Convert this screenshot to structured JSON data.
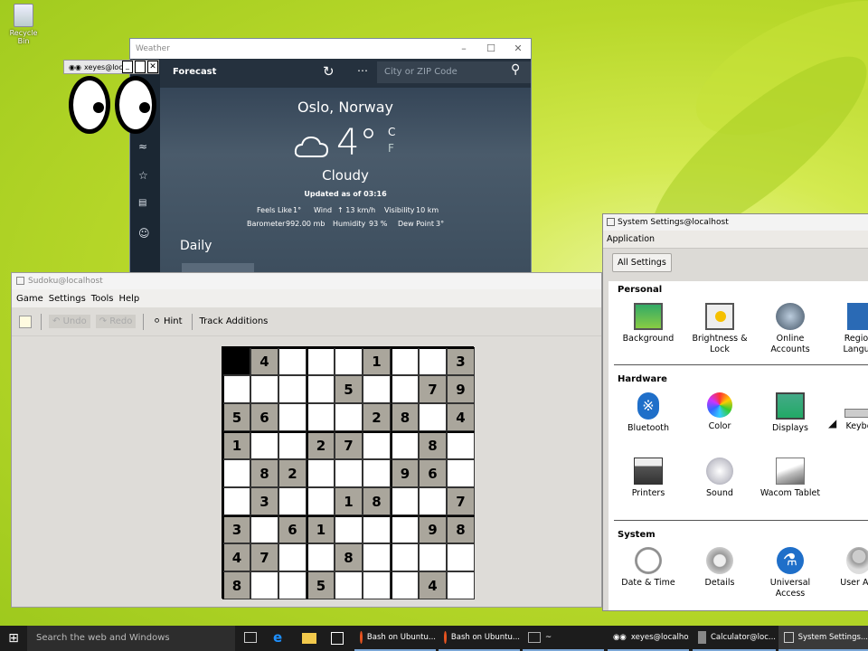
{
  "desktop": {
    "recycle_bin_label": "Recycle Bin"
  },
  "weather": {
    "window_title": "Weather",
    "header": "Forecast",
    "search_placeholder": "City or ZIP Code",
    "city": "Oslo, Norway",
    "temperature": "4°",
    "unit_c": "C",
    "unit_f": "F",
    "condition": "Cloudy",
    "updated": "Updated as of 03:16",
    "feels_like_label": "Feels Like",
    "feels_like": "1°",
    "wind_label": "Wind",
    "wind": "13 km/h",
    "visibility_label": "Visibility",
    "visibility": "10 km",
    "barometer_label": "Barometer",
    "barometer": "992.00 mb",
    "humidity_label": "Humidity",
    "humidity": "93 %",
    "dewpoint_label": "Dew Point",
    "dewpoint": "3°",
    "daily_label": "Daily"
  },
  "xeyes": {
    "title": "xeyes@loc..."
  },
  "sudoku": {
    "window_title": "Sudoku@localhost",
    "menu": [
      "Game",
      "Settings",
      "Tools",
      "Help"
    ],
    "toolbar": {
      "undo": "Undo",
      "redo": "Redo",
      "hint": "Hint",
      "track": "Track Additions"
    },
    "grid": [
      [
        "#",
        "4",
        "",
        "",
        "",
        "1",
        "",
        "",
        "3"
      ],
      [
        "",
        "",
        "",
        "",
        "5",
        "",
        "",
        "7",
        "9"
      ],
      [
        "5",
        "6",
        "",
        "",
        "",
        "2",
        "8",
        "",
        "4"
      ],
      [
        "1",
        "",
        "",
        "2",
        "7",
        "",
        "",
        "8",
        ""
      ],
      [
        "",
        "8",
        "2",
        "",
        "",
        "",
        "9",
        "6",
        ""
      ],
      [
        "",
        "3",
        "",
        "",
        "1",
        "8",
        "",
        "",
        "7"
      ],
      [
        "3",
        "",
        "6",
        "1",
        "",
        "",
        "",
        "9",
        "8"
      ],
      [
        "4",
        "7",
        "",
        "",
        "8",
        "",
        "",
        "",
        ""
      ],
      [
        "8",
        "",
        "",
        "5",
        "",
        "",
        "",
        "4",
        ""
      ]
    ]
  },
  "settings": {
    "window_title": "System Settings@localhost",
    "menu": "Application",
    "all_settings": "All Settings",
    "personal_label": "Personal",
    "personal": [
      {
        "label": "Background",
        "icon": "background-icon"
      },
      {
        "label": "Brightness & Lock",
        "icon": "brightness-icon"
      },
      {
        "label": "Online Accounts",
        "icon": "online-accounts-icon"
      },
      {
        "label": "Region & Language",
        "icon": "region-icon",
        "visible": "Region Langua"
      }
    ],
    "hardware_label": "Hardware",
    "hardware": [
      {
        "label": "Bluetooth",
        "icon": "bluetooth-icon"
      },
      {
        "label": "Color",
        "icon": "color-icon"
      },
      {
        "label": "Displays",
        "icon": "displays-icon"
      },
      {
        "label": "Keyboard",
        "icon": "keyboard-icon",
        "visible": "Keybo"
      },
      {
        "label": "Printers",
        "icon": "printers-icon"
      },
      {
        "label": "Sound",
        "icon": "sound-icon"
      },
      {
        "label": "Wacom Tablet",
        "icon": "wacom-icon"
      }
    ],
    "system_label": "System",
    "system": [
      {
        "label": "Date & Time",
        "icon": "clock-icon"
      },
      {
        "label": "Details",
        "icon": "details-icon"
      },
      {
        "label": "Universal Access",
        "icon": "universal-access-icon"
      },
      {
        "label": "User Acc",
        "icon": "user-accounts-icon"
      }
    ]
  },
  "taskbar": {
    "search_placeholder": "Search the web and Windows",
    "buttons": [
      "Bash on Ubuntu...",
      "Bash on Ubuntu...",
      "~",
      "xeyes@localhost",
      "Calculator@loc...",
      "System Settings..."
    ]
  }
}
